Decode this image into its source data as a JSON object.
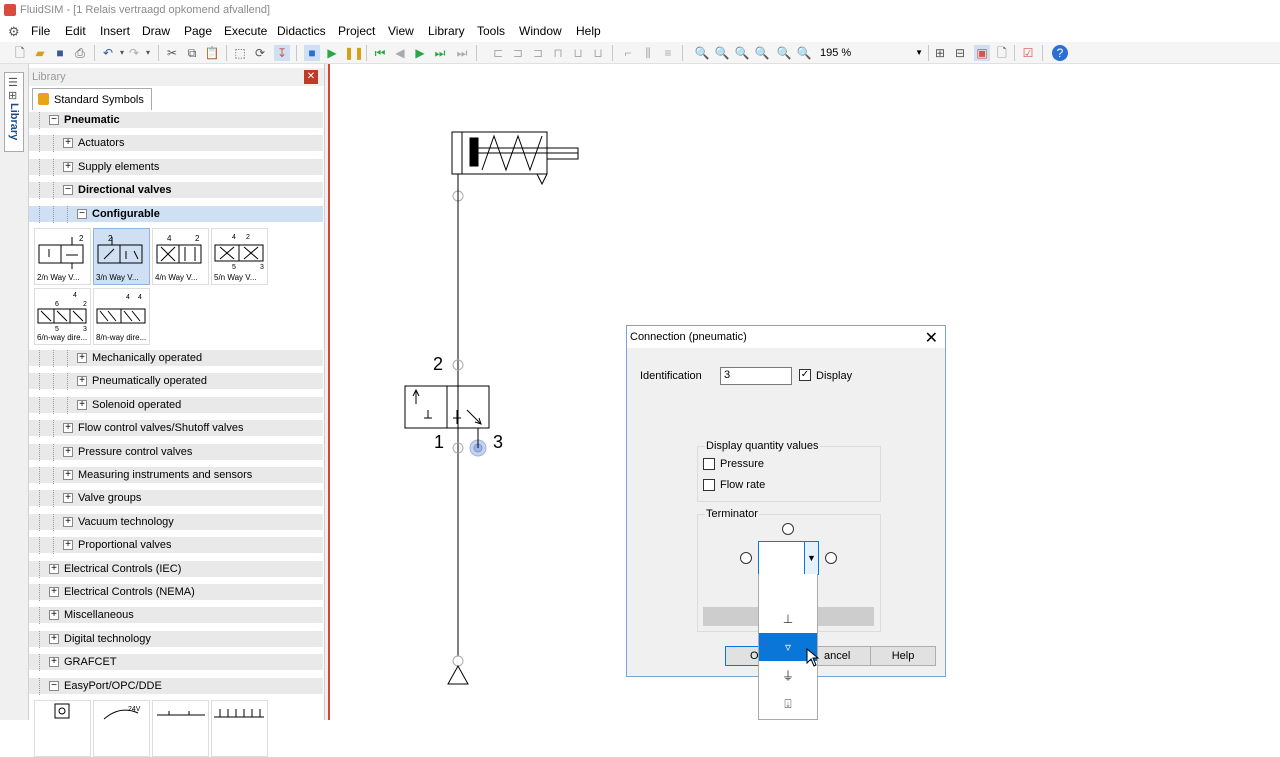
{
  "window": {
    "title": "FluidSIM - [1 Relais vertraagd opkomend afvallend]"
  },
  "menu": [
    "File",
    "Edit",
    "Insert",
    "Draw",
    "Page",
    "Execute",
    "Didactics",
    "Project",
    "View",
    "Library",
    "Tools",
    "Window",
    "Help"
  ],
  "toolbar": {
    "zoom_value": "195 %"
  },
  "sidebar": {
    "tab_label": "Library"
  },
  "library": {
    "title": "Library",
    "tab": "Standard Symbols",
    "tree": [
      {
        "label": "Pneumatic",
        "expanded": true,
        "bold": true,
        "level": 0
      },
      {
        "label": "Actuators",
        "expanded": false,
        "bold": false,
        "level": 1
      },
      {
        "label": "Supply elements",
        "expanded": false,
        "bold": false,
        "level": 1
      },
      {
        "label": "Directional valves",
        "expanded": true,
        "bold": true,
        "level": 1
      },
      {
        "label": "Configurable",
        "expanded": true,
        "bold": true,
        "level": 2,
        "selected": true
      }
    ],
    "symbols": [
      "2/n Way V...",
      "3/n Way V...",
      "4/n Way V...",
      "5/n Way V...",
      "6/n-way dire...",
      "8/n-way dire..."
    ],
    "tree2": [
      {
        "label": "Mechanically operated",
        "level": 2
      },
      {
        "label": "Pneumatically operated",
        "level": 2
      },
      {
        "label": "Solenoid operated",
        "level": 2
      },
      {
        "label": "Flow control valves/Shutoff valves",
        "level": 1
      },
      {
        "label": "Pressure control valves",
        "level": 1
      },
      {
        "label": "Measuring instruments and sensors",
        "level": 1
      },
      {
        "label": "Valve groups",
        "level": 1
      },
      {
        "label": "Vacuum technology",
        "level": 1
      },
      {
        "label": "Proportional valves",
        "level": 1
      },
      {
        "label": "Electrical Controls (IEC)",
        "level": 0
      },
      {
        "label": "Electrical Controls (NEMA)",
        "level": 0
      },
      {
        "label": "Miscellaneous",
        "level": 0
      },
      {
        "label": "Digital technology",
        "level": 0
      },
      {
        "label": "GRAFCET",
        "level": 0
      },
      {
        "label": "EasyPort/OPC/DDE",
        "level": 0,
        "expanded": true
      }
    ]
  },
  "canvas": {
    "port_2": "2",
    "port_1": "1",
    "port_3": "3"
  },
  "dialog": {
    "title": "Connection (pneumatic)",
    "identification_label": "Identification",
    "identification_value": "3",
    "display_label": "Display",
    "display_checked": true,
    "quantity_group": "Display quantity values",
    "pressure_label": "Pressure",
    "flowrate_label": "Flow rate",
    "terminator_group": "Terminator",
    "ok_label": "O",
    "cancel_label": "ancel",
    "help_label": "Help",
    "dropdown_items": [
      "",
      "⊥",
      "▿",
      "⏚",
      "⍗"
    ]
  }
}
